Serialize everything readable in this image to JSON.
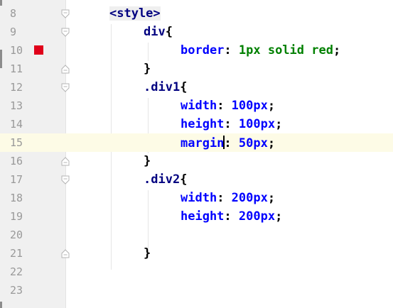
{
  "editor": {
    "current_line": "15",
    "breakpoint_line": "10",
    "lines": [
      {
        "num": "8",
        "tokens": [
          {
            "t": "<style>",
            "c": "tag"
          }
        ]
      },
      {
        "num": "9",
        "tokens": [
          {
            "t": "div",
            "c": "sel"
          },
          {
            "t": "{",
            "c": "plain"
          }
        ]
      },
      {
        "num": "10",
        "tokens": [
          {
            "t": "border",
            "c": "prop"
          },
          {
            "t": ": ",
            "c": "plain"
          },
          {
            "t": "1px solid red",
            "c": "val"
          },
          {
            "t": ";",
            "c": "plain"
          }
        ]
      },
      {
        "num": "11",
        "tokens": [
          {
            "t": "}",
            "c": "plain"
          }
        ]
      },
      {
        "num": "12",
        "tokens": [
          {
            "t": ".div1",
            "c": "sel"
          },
          {
            "t": "{",
            "c": "plain"
          }
        ]
      },
      {
        "num": "13",
        "tokens": [
          {
            "t": "width",
            "c": "prop"
          },
          {
            "t": ": ",
            "c": "plain"
          },
          {
            "t": "100",
            "c": "prop"
          },
          {
            "t": "px",
            "c": "prop"
          },
          {
            "t": ";",
            "c": "plain"
          }
        ]
      },
      {
        "num": "14",
        "tokens": [
          {
            "t": "height",
            "c": "prop"
          },
          {
            "t": ": ",
            "c": "plain"
          },
          {
            "t": "100",
            "c": "prop"
          },
          {
            "t": "px",
            "c": "prop"
          },
          {
            "t": ";",
            "c": "plain"
          }
        ]
      },
      {
        "num": "15",
        "tokens": [
          {
            "t": "margin",
            "c": "prop"
          },
          {
            "t": ": ",
            "c": "plain"
          },
          {
            "t": "50",
            "c": "prop"
          },
          {
            "t": "px",
            "c": "prop"
          },
          {
            "t": ";",
            "c": "plain"
          }
        ]
      },
      {
        "num": "16",
        "tokens": [
          {
            "t": "}",
            "c": "plain"
          }
        ]
      },
      {
        "num": "17",
        "tokens": [
          {
            "t": ".div2",
            "c": "sel"
          },
          {
            "t": "{",
            "c": "plain"
          }
        ]
      },
      {
        "num": "18",
        "tokens": [
          {
            "t": "width",
            "c": "prop"
          },
          {
            "t": ": ",
            "c": "plain"
          },
          {
            "t": "200",
            "c": "prop"
          },
          {
            "t": "px",
            "c": "prop"
          },
          {
            "t": ";",
            "c": "plain"
          }
        ]
      },
      {
        "num": "19",
        "tokens": [
          {
            "t": "height",
            "c": "prop"
          },
          {
            "t": ": ",
            "c": "plain"
          },
          {
            "t": "200",
            "c": "prop"
          },
          {
            "t": "px",
            "c": "prop"
          },
          {
            "t": ";",
            "c": "plain"
          }
        ]
      },
      {
        "num": "20",
        "tokens": []
      },
      {
        "num": "21",
        "tokens": [
          {
            "t": "}",
            "c": "plain"
          }
        ]
      },
      {
        "num": "22",
        "tokens": []
      },
      {
        "num": "23",
        "tokens": []
      }
    ]
  },
  "colors": {
    "tag": "#000080",
    "selector": "#000080",
    "property": "#0000ff",
    "value": "#008000",
    "breakpoint": "#e0001a",
    "current_line_bg": "#fdfbe6"
  }
}
